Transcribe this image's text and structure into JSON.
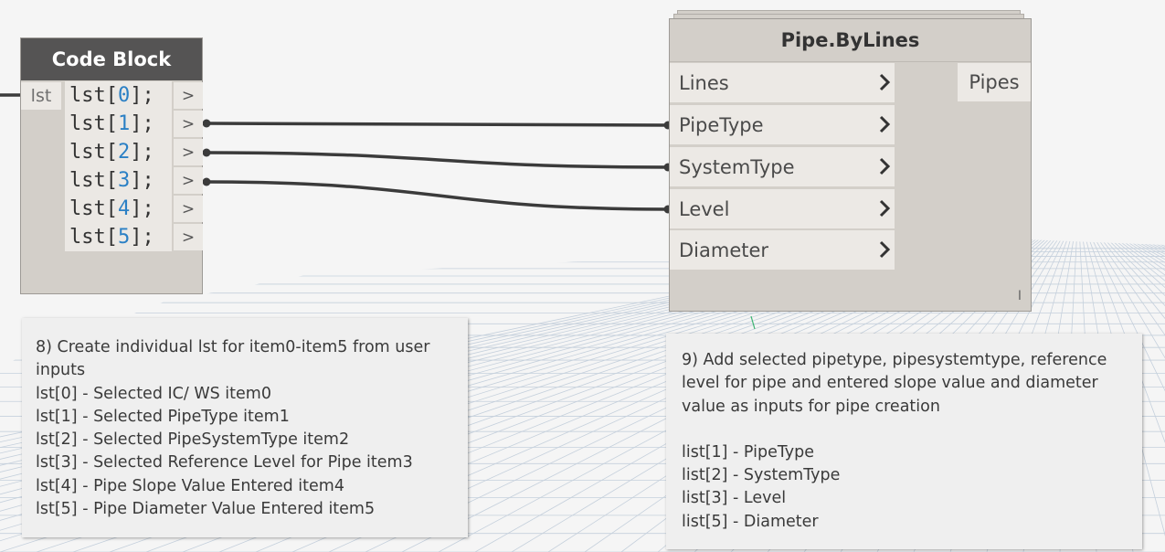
{
  "code_block": {
    "title": "Code Block",
    "input_port": "lst",
    "lines": [
      {
        "pre": "lst[",
        "index": "0",
        "post": "];"
      },
      {
        "pre": "lst[",
        "index": "1",
        "post": "];"
      },
      {
        "pre": "lst[",
        "index": "2",
        "post": "];"
      },
      {
        "pre": "lst[",
        "index": "3",
        "post": "];"
      },
      {
        "pre": "lst[",
        "index": "4",
        "post": "];"
      },
      {
        "pre": "lst[",
        "index": "5",
        "post": "];"
      }
    ],
    "output_port_glyph": ">"
  },
  "pipe_node": {
    "title": "Pipe.ByLines",
    "inputs": [
      "Lines",
      "PipeType",
      "SystemType",
      "Level",
      "Diameter"
    ],
    "output": "Pipes",
    "lacing": "I"
  },
  "note8": {
    "lines": [
      "8) Create individual lst for item0-item5 from user",
      "inputs",
      "lst[0] - Selected IC/ WS item0",
      "lst[1] - Selected PipeType item1",
      "lst[2] - Selected PipeSystemType item2",
      "lst[3] - Selected Reference Level for Pipe item3",
      "lst[4] - Pipe Slope Value Entered item4",
      "lst[5] - Pipe Diameter Value Entered item5"
    ]
  },
  "note9": {
    "lines": [
      "9) Add selected pipetype, pipesystemtype, reference",
      "level for pipe and entered slope value and diameter",
      "value as inputs for pipe creation",
      "",
      "list[1] - PipeType",
      "list[2] - SystemType",
      "list[3] - Level",
      "list[5] - Diameter"
    ]
  },
  "colors": {
    "canvas": "#f5f5f5",
    "node_body": "#d3cfc9",
    "code_block_header": "#555454",
    "wire": "#3b3b3b",
    "code_number": "#2b80c5",
    "note_bg": "#efefef"
  }
}
